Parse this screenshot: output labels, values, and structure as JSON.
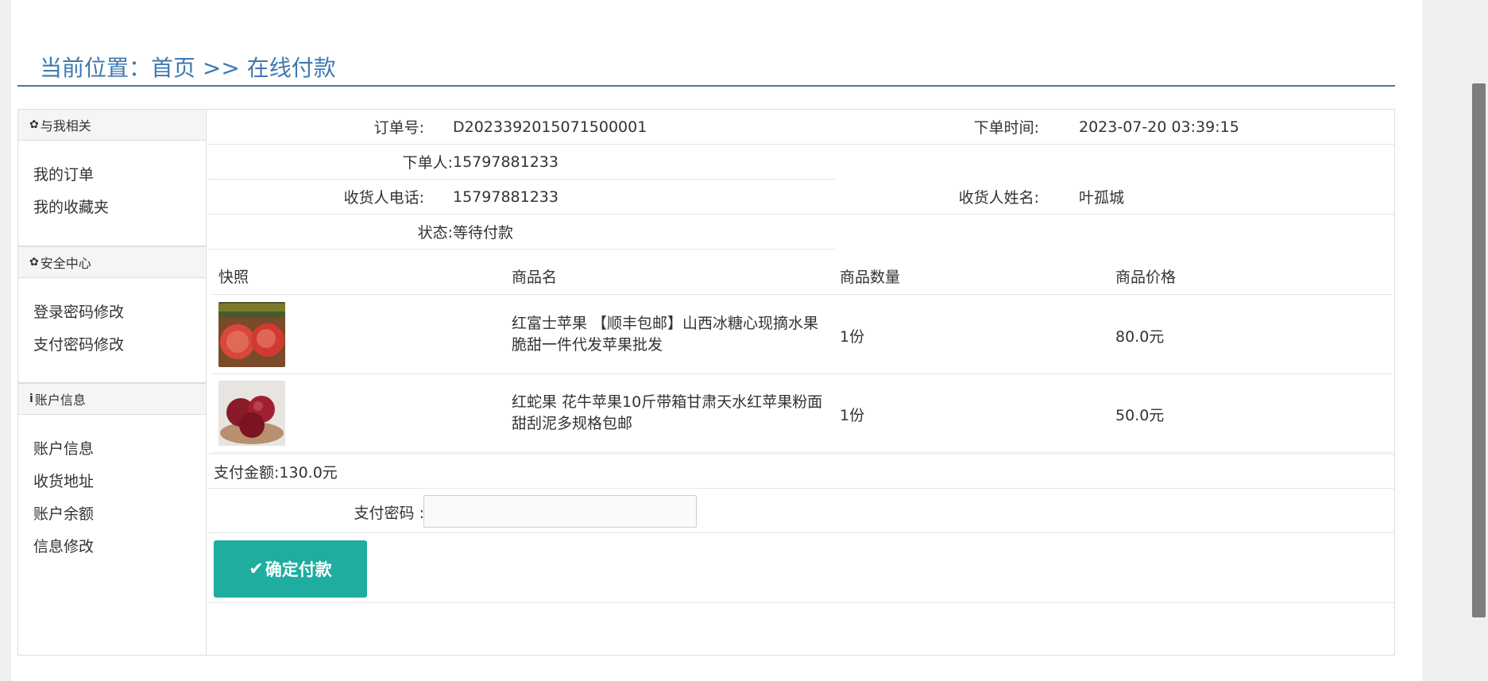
{
  "breadcrumb": "当前位置：首页 >> 在线付款",
  "sidebar": {
    "sections": [
      {
        "title": "与我相关",
        "icon": "gear-icon",
        "items": [
          "我的订单",
          "我的收藏夹"
        ]
      },
      {
        "title": "安全中心",
        "icon": "gear-icon",
        "items": [
          "登录密码修改",
          "支付密码修改"
        ]
      },
      {
        "title": "账户信息",
        "icon": "info-icon",
        "items": [
          "账户信息",
          "收货地址",
          "账户余额",
          "信息修改"
        ]
      }
    ]
  },
  "order": {
    "order_no_label": "订单号:",
    "order_no": "D2023392015071500001",
    "time_label": "下单时间:",
    "time": "2023-07-20 03:39:15",
    "buyer_label": "下单人:",
    "buyer": "15797881233",
    "phone_label": "收货人电话:",
    "phone": "15797881233",
    "receiver_label": "收货人姓名:",
    "receiver": "叶孤城",
    "status_label": "状态:",
    "status": "等待付款"
  },
  "table": {
    "headers": [
      "快照",
      "商品名",
      "商品数量",
      "商品价格"
    ],
    "rows": [
      {
        "name": "红富士苹果 【顺丰包邮】山西冰糖心现摘水果脆甜一件代发苹果批发",
        "qty": "1份",
        "price": "80.0元",
        "thumb": "apple-photo"
      },
      {
        "name": "红蛇果 花牛苹果10斤带箱甘肃天水红苹果粉面甜刮泥多规格包邮",
        "qty": "1份",
        "price": "50.0元",
        "thumb": "red-apple-photo"
      }
    ]
  },
  "payment": {
    "total": "支付金额:130.0元",
    "password_label": "支付密码 :",
    "password_value": "",
    "button_label": "确定付款"
  },
  "colors": {
    "accent": "#3f78b0",
    "button": "#1fada0"
  }
}
